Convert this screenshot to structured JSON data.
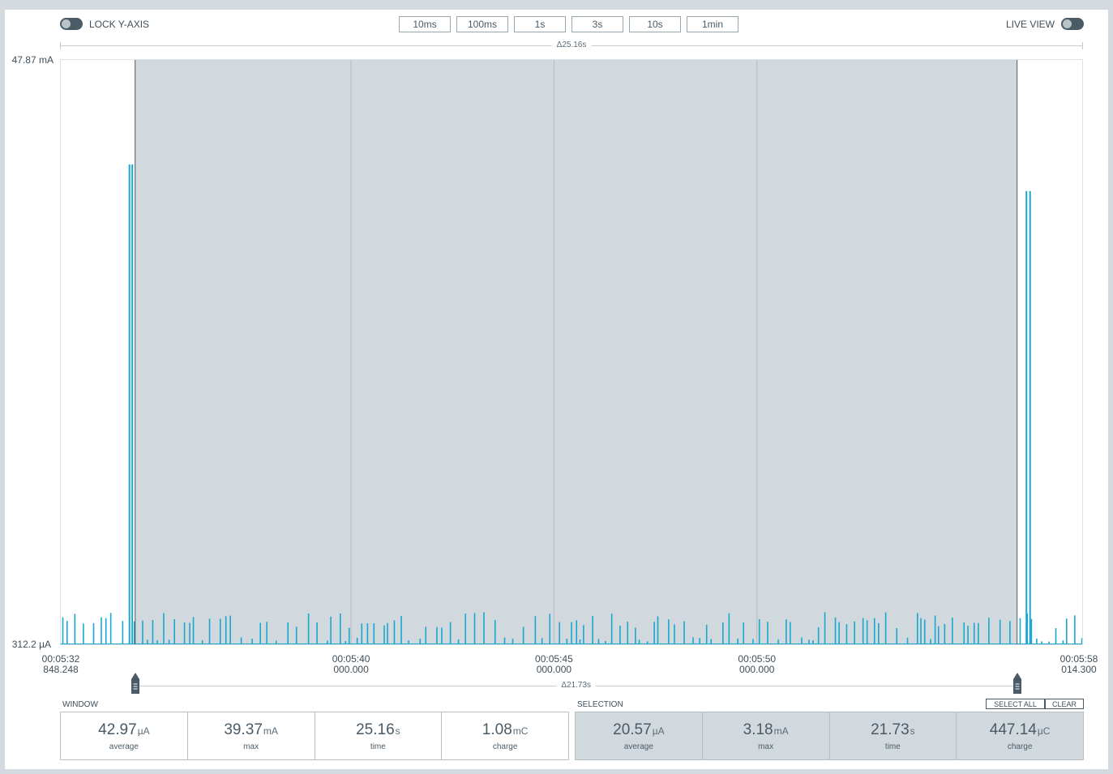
{
  "toolbar": {
    "lock_y_axis_label": "LOCK Y-AXIS",
    "live_view_label": "LIVE VIEW",
    "zoom_options": [
      "10ms",
      "100ms",
      "1s",
      "3s",
      "10s",
      "1min"
    ]
  },
  "window_range": {
    "delta_label": "Δ25.16s"
  },
  "selection_range": {
    "delta_label": "Δ21.73s"
  },
  "chart_data": {
    "type": "line",
    "y_top_label": "47.87 mA",
    "y_bottom_label": "312.2 µA",
    "x_ticks": [
      {
        "time": "00:05:32",
        "sub": "848.248"
      },
      {
        "time": "00:05:40",
        "sub": "000.000"
      },
      {
        "time": "00:05:45",
        "sub": "000.000"
      },
      {
        "time": "00:05:50",
        "sub": "000.000"
      },
      {
        "time": "00:05:58",
        "sub": "014.300"
      }
    ],
    "x_range_s": [
      332.848,
      358.014
    ],
    "x_tick_positions_s": [
      332.848,
      340,
      345,
      350,
      358.014
    ],
    "gridlines_s": [
      340,
      345,
      350
    ],
    "y_range_mA": [
      0.3122,
      47.87
    ],
    "selection_s": [
      334.68,
      356.41
    ],
    "spikes_mA": [
      {
        "t": 334.54,
        "v": 39.37
      },
      {
        "t": 334.61,
        "v": 39.37
      },
      {
        "t": 356.64,
        "v": 37.2
      },
      {
        "t": 356.73,
        "v": 37.2
      }
    ],
    "line_color": "#1aa7cf",
    "selection_color": "#d1d9de"
  },
  "window_stats": {
    "title": "WINDOW",
    "items": [
      {
        "value": "42.97",
        "unit": "µA",
        "label": "average"
      },
      {
        "value": "39.37",
        "unit": "mA",
        "label": "max"
      },
      {
        "value": "25.16",
        "unit": "s",
        "label": "time"
      },
      {
        "value": "1.08",
        "unit": "mC",
        "label": "charge"
      }
    ]
  },
  "selection_stats": {
    "title": "SELECTION",
    "select_all_label": "SELECT ALL",
    "clear_label": "CLEAR",
    "items": [
      {
        "value": "20.57",
        "unit": "µA",
        "label": "average"
      },
      {
        "value": "3.18",
        "unit": "mA",
        "label": "max"
      },
      {
        "value": "21.73",
        "unit": "s",
        "label": "time"
      },
      {
        "value": "447.14",
        "unit": "µC",
        "label": "charge"
      }
    ]
  }
}
